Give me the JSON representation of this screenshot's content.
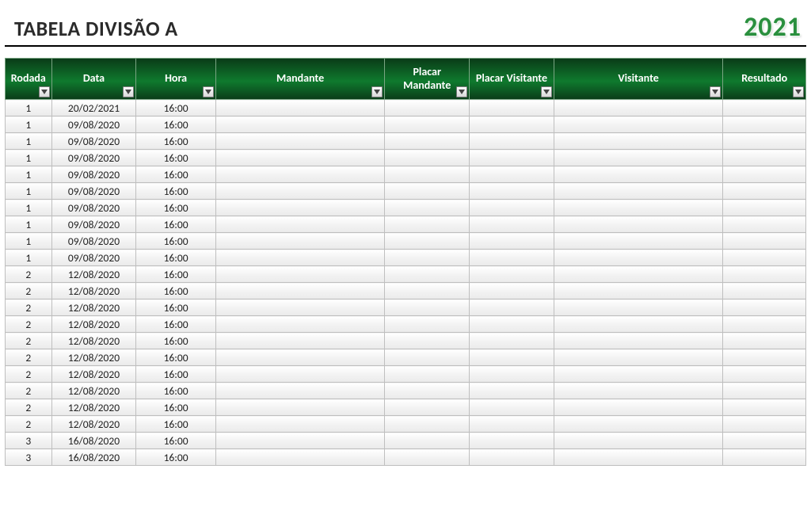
{
  "header": {
    "title": "TABELA DIVISÃO A",
    "year": "2021"
  },
  "columns": [
    {
      "key": "rodada",
      "label": "Rodada"
    },
    {
      "key": "data",
      "label": "Data"
    },
    {
      "key": "hora",
      "label": "Hora"
    },
    {
      "key": "mandante",
      "label": "Mandante"
    },
    {
      "key": "placarMandante",
      "label": "Placar Mandante"
    },
    {
      "key": "placarVisitante",
      "label": "Placar Visitante"
    },
    {
      "key": "visitante",
      "label": "Visitante"
    },
    {
      "key": "resultado",
      "label": "Resultado"
    }
  ],
  "rows": [
    {
      "rodada": "1",
      "data": "20/02/2021",
      "hora": "16:00",
      "mandante": "",
      "placarMandante": "",
      "placarVisitante": "",
      "visitante": "",
      "resultado": ""
    },
    {
      "rodada": "1",
      "data": "09/08/2020",
      "hora": "16:00",
      "mandante": "",
      "placarMandante": "",
      "placarVisitante": "",
      "visitante": "",
      "resultado": ""
    },
    {
      "rodada": "1",
      "data": "09/08/2020",
      "hora": "16:00",
      "mandante": "",
      "placarMandante": "",
      "placarVisitante": "",
      "visitante": "",
      "resultado": ""
    },
    {
      "rodada": "1",
      "data": "09/08/2020",
      "hora": "16:00",
      "mandante": "",
      "placarMandante": "",
      "placarVisitante": "",
      "visitante": "",
      "resultado": ""
    },
    {
      "rodada": "1",
      "data": "09/08/2020",
      "hora": "16:00",
      "mandante": "",
      "placarMandante": "",
      "placarVisitante": "",
      "visitante": "",
      "resultado": ""
    },
    {
      "rodada": "1",
      "data": "09/08/2020",
      "hora": "16:00",
      "mandante": "",
      "placarMandante": "",
      "placarVisitante": "",
      "visitante": "",
      "resultado": ""
    },
    {
      "rodada": "1",
      "data": "09/08/2020",
      "hora": "16:00",
      "mandante": "",
      "placarMandante": "",
      "placarVisitante": "",
      "visitante": "",
      "resultado": ""
    },
    {
      "rodada": "1",
      "data": "09/08/2020",
      "hora": "16:00",
      "mandante": "",
      "placarMandante": "",
      "placarVisitante": "",
      "visitante": "",
      "resultado": ""
    },
    {
      "rodada": "1",
      "data": "09/08/2020",
      "hora": "16:00",
      "mandante": "",
      "placarMandante": "",
      "placarVisitante": "",
      "visitante": "",
      "resultado": ""
    },
    {
      "rodada": "1",
      "data": "09/08/2020",
      "hora": "16:00",
      "mandante": "",
      "placarMandante": "",
      "placarVisitante": "",
      "visitante": "",
      "resultado": ""
    },
    {
      "rodada": "2",
      "data": "12/08/2020",
      "hora": "16:00",
      "mandante": "",
      "placarMandante": "",
      "placarVisitante": "",
      "visitante": "",
      "resultado": ""
    },
    {
      "rodada": "2",
      "data": "12/08/2020",
      "hora": "16:00",
      "mandante": "",
      "placarMandante": "",
      "placarVisitante": "",
      "visitante": "",
      "resultado": ""
    },
    {
      "rodada": "2",
      "data": "12/08/2020",
      "hora": "16:00",
      "mandante": "",
      "placarMandante": "",
      "placarVisitante": "",
      "visitante": "",
      "resultado": ""
    },
    {
      "rodada": "2",
      "data": "12/08/2020",
      "hora": "16:00",
      "mandante": "",
      "placarMandante": "",
      "placarVisitante": "",
      "visitante": "",
      "resultado": ""
    },
    {
      "rodada": "2",
      "data": "12/08/2020",
      "hora": "16:00",
      "mandante": "",
      "placarMandante": "",
      "placarVisitante": "",
      "visitante": "",
      "resultado": ""
    },
    {
      "rodada": "2",
      "data": "12/08/2020",
      "hora": "16:00",
      "mandante": "",
      "placarMandante": "",
      "placarVisitante": "",
      "visitante": "",
      "resultado": ""
    },
    {
      "rodada": "2",
      "data": "12/08/2020",
      "hora": "16:00",
      "mandante": "",
      "placarMandante": "",
      "placarVisitante": "",
      "visitante": "",
      "resultado": ""
    },
    {
      "rodada": "2",
      "data": "12/08/2020",
      "hora": "16:00",
      "mandante": "",
      "placarMandante": "",
      "placarVisitante": "",
      "visitante": "",
      "resultado": ""
    },
    {
      "rodada": "2",
      "data": "12/08/2020",
      "hora": "16:00",
      "mandante": "",
      "placarMandante": "",
      "placarVisitante": "",
      "visitante": "",
      "resultado": ""
    },
    {
      "rodada": "2",
      "data": "12/08/2020",
      "hora": "16:00",
      "mandante": "",
      "placarMandante": "",
      "placarVisitante": "",
      "visitante": "",
      "resultado": ""
    },
    {
      "rodada": "3",
      "data": "16/08/2020",
      "hora": "16:00",
      "mandante": "",
      "placarMandante": "",
      "placarVisitante": "",
      "visitante": "",
      "resultado": ""
    },
    {
      "rodada": "3",
      "data": "16/08/2020",
      "hora": "16:00",
      "mandante": "",
      "placarMandante": "",
      "placarVisitante": "",
      "visitante": "",
      "resultado": ""
    }
  ]
}
